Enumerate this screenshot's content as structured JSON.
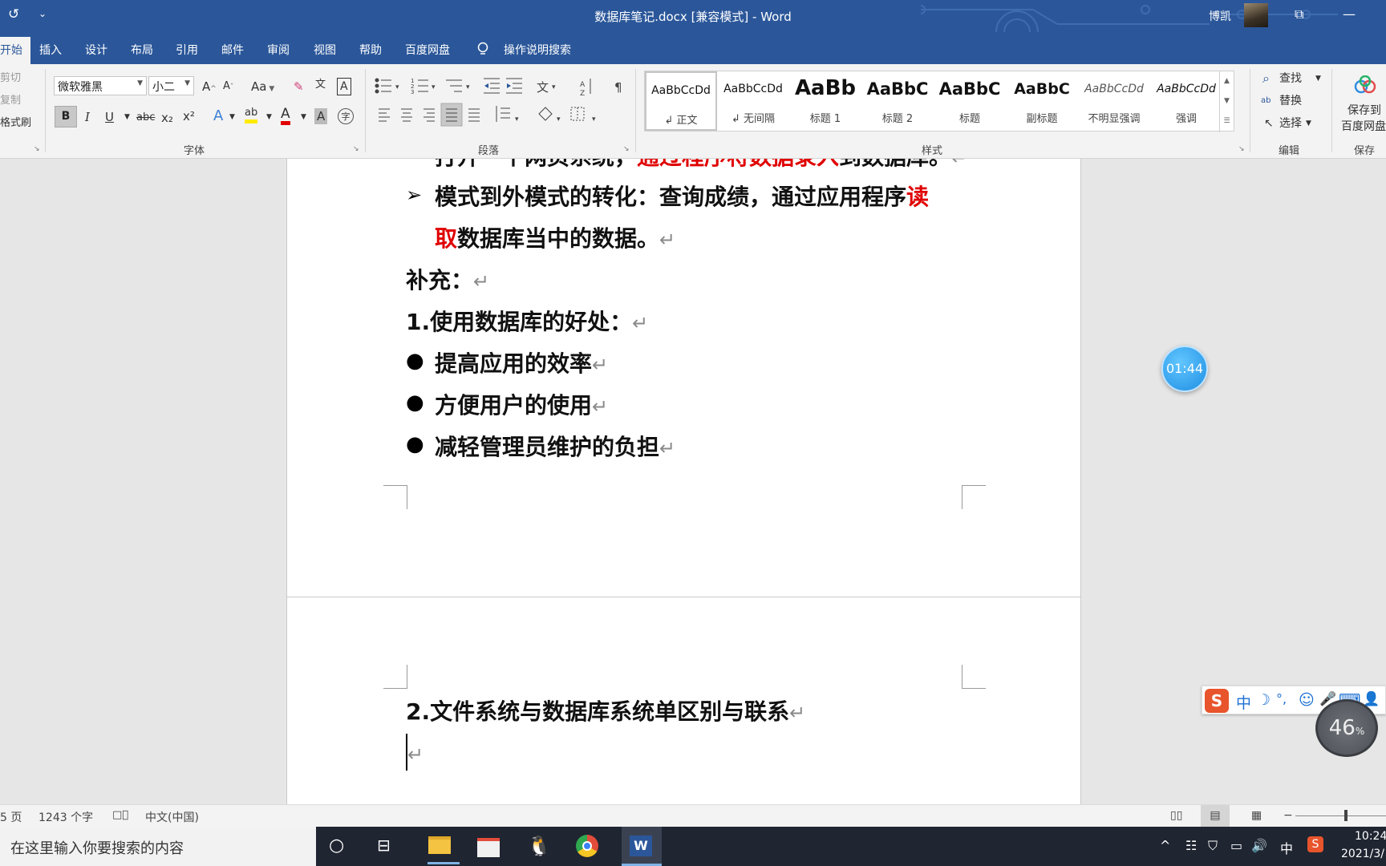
{
  "titlebar": {
    "doc_title": "数据库笔记.docx [兼容模式]  -  Word",
    "user_name": "博凯",
    "qa_refresh_glyph": "↺",
    "qa_more_glyph": "⌄",
    "restore_glyph": "⧉",
    "minimize_glyph": "—"
  },
  "tabs": [
    "开始",
    "插入",
    "设计",
    "布局",
    "引用",
    "邮件",
    "审阅",
    "视图",
    "帮助",
    "百度网盘"
  ],
  "tell_me": "操作说明搜索",
  "ribbon": {
    "clipboard": {
      "cut": "剪切",
      "copy": "复制",
      "format_painter": "格式刷"
    },
    "font": {
      "group_label": "字体",
      "font_name": "微软雅黑",
      "font_size": "小二",
      "grow": "A",
      "shrink": "A",
      "case": "Aa",
      "bold": "B",
      "italic": "I",
      "underline": "U",
      "strike": "abc",
      "sub": "x₂",
      "sup": "x²",
      "effects": "A",
      "highlight": "ab",
      "color": "A",
      "shade": "A",
      "enclose": "字",
      "clear": "✎",
      "phonetic": "文",
      "border": "A"
    },
    "paragraph": {
      "group_label": "段落"
    },
    "styles": {
      "group_label": "样式",
      "items": [
        {
          "preview": "AaBbCcDd",
          "name": "↲ 正文"
        },
        {
          "preview": "AaBbCcDd",
          "name": "↲ 无间隔"
        },
        {
          "preview": "AaBb",
          "name": "标题 1"
        },
        {
          "preview": "AaBbC",
          "name": "标题 2"
        },
        {
          "preview": "AaBbC",
          "name": "标题"
        },
        {
          "preview": "AaBbC",
          "name": "副标题"
        },
        {
          "preview": "AaBbCcDd",
          "name": "不明显强调"
        },
        {
          "preview": "AaBbCcDd",
          "name": "强调"
        }
      ]
    },
    "editing": {
      "group_label": "编辑",
      "find": "查找",
      "replace": "替换",
      "select": "选择"
    },
    "save": {
      "group_label": "保存",
      "button_line1": "保存到",
      "button_line2": "百度网盘"
    }
  },
  "document": {
    "page1": {
      "line_top_black1": "打开一个网页系统，",
      "line_top_red": "通过程序将数据录入",
      "line_top_black2": "到数据库。",
      "arrow": "➢",
      "line1_black": "模式到外模式的转化：查询成绩，通过应用程序",
      "line1_red": "读",
      "line2_red": "取",
      "line2_black": "数据库当中的数据。",
      "supplement": "补充：",
      "heading1": "1.使用数据库的好处：",
      "bullet": "●",
      "bullets": [
        "提高应用的效率",
        "方便用户的使用",
        "减轻管理员维护的负担"
      ],
      "para_mark": "↵"
    },
    "page2": {
      "heading2": "2.文件系统与数据库系统单区别与联系"
    }
  },
  "overlays": {
    "timer": "01:44",
    "ime": {
      "logo": "S",
      "lang": "中",
      "moon": "☽",
      "punct": "°,",
      "emoji": "☺",
      "mic": "🎤",
      "keyboard": "⌨",
      "user": "👤"
    },
    "gauge_value": "46",
    "gauge_unit": "%"
  },
  "status": {
    "page": "5 页",
    "words": "1243 个字",
    "lang": "中文(中国)",
    "zoom_minus": "−"
  },
  "taskbar": {
    "search_placeholder": "在这里输入你要搜索的内容",
    "time": "10:24",
    "date": "2021/3/",
    "ime_lang": "中"
  }
}
